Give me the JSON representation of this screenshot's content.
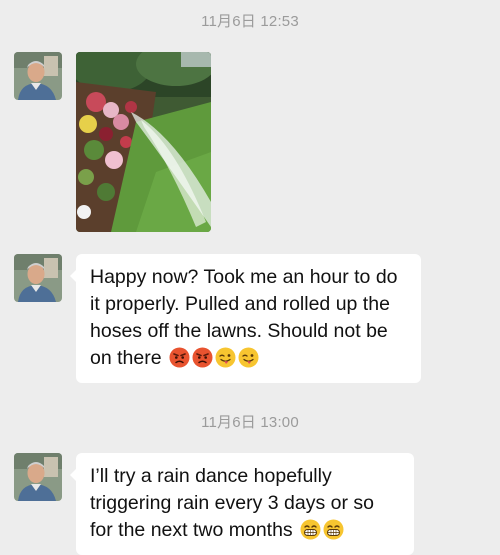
{
  "conversation": {
    "timestamps": [
      "11月6日 12:53",
      "11月6日 13:00"
    ],
    "messages": [
      {
        "type": "image",
        "content": "garden-sprinkler-photo"
      },
      {
        "type": "text",
        "text": "Happy now? Took me an hour to do it properly. Pulled and rolled up the hoses off the lawns. Should not be on there",
        "emojis": [
          "angry-face-icon",
          "angry-face-icon",
          "winking-tongue-face-icon",
          "winking-tongue-face-icon"
        ]
      },
      {
        "type": "text",
        "text": "I’ll try a rain dance hopefully triggering rain every 3 days or so for the next two months",
        "emojis": [
          "grinning-face-icon",
          "grinning-face-icon"
        ]
      }
    ]
  },
  "colors": {
    "background": "#ededed",
    "bubble": "#ffffff",
    "timestamp_text": "#9b9b9b",
    "message_text": "#111111"
  }
}
